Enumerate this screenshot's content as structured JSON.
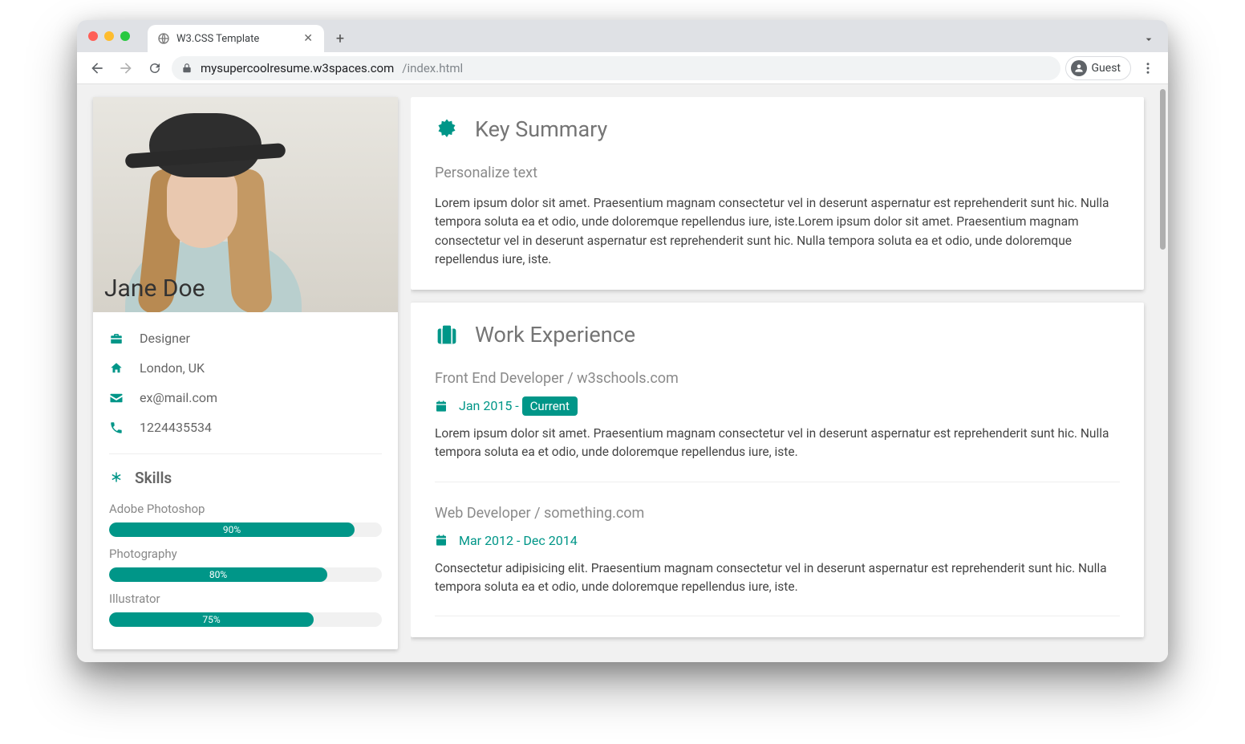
{
  "browser": {
    "tab_title": "W3.CSS Template",
    "url_host": "mysupercoolresume.w3spaces.com",
    "url_path": "/index.html",
    "guest_label": "Guest"
  },
  "profile": {
    "name": "Jane Doe",
    "role": "Designer",
    "location": "London, UK",
    "email": "ex@mail.com",
    "phone": "1224435534"
  },
  "skills_heading": "Skills",
  "skills": [
    {
      "name": "Adobe Photoshop",
      "pct": 90,
      "pct_label": "90%"
    },
    {
      "name": "Photography",
      "pct": 80,
      "pct_label": "80%"
    },
    {
      "name": "Illustrator",
      "pct": 75,
      "pct_label": "75%"
    }
  ],
  "summary": {
    "heading": "Key Summary",
    "sub": "Personalize text",
    "body": "Lorem ipsum dolor sit amet. Praesentium magnam consectetur vel in deserunt aspernatur est reprehenderit sunt hic. Nulla tempora soluta ea et odio, unde doloremque repellendus iure, iste.Lorem ipsum dolor sit amet. Praesentium magnam consectetur vel in deserunt aspernatur est reprehenderit sunt hic. Nulla tempora soluta ea et odio, unde doloremque repellendus iure, iste."
  },
  "work": {
    "heading": "Work Experience",
    "jobs": [
      {
        "title": "Front End Developer / w3schools.com",
        "dates": "Jan 2015 - ",
        "badge": "Current",
        "desc": "Lorem ipsum dolor sit amet. Praesentium magnam consectetur vel in deserunt aspernatur est reprehenderit sunt hic. Nulla tempora soluta ea et odio, unde doloremque repellendus iure, iste."
      },
      {
        "title": "Web Developer / something.com",
        "dates": "Mar 2012 - Dec 2014",
        "badge": "",
        "desc": "Consectetur adipisicing elit. Praesentium magnam consectetur vel in deserunt aspernatur est reprehenderit sunt hic. Nulla tempora soluta ea et odio, unde doloremque repellendus iure, iste."
      }
    ]
  },
  "colors": {
    "teal": "#009688"
  }
}
